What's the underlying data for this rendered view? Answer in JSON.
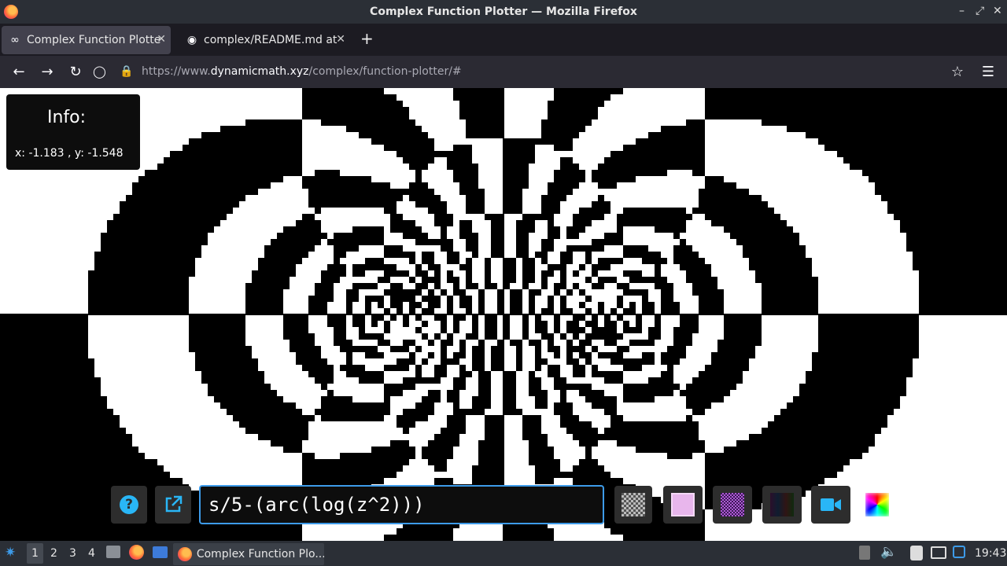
{
  "window": {
    "title": "Complex Function Plotter — Mozilla Firefox",
    "minimize_icon": "minimize-icon",
    "restore_icon": "restore-icon",
    "close_icon": "close-icon"
  },
  "tabs": [
    {
      "label": "Complex Function Plotter",
      "icon": "infinity-icon",
      "active": true
    },
    {
      "label": "complex/README.md at",
      "icon": "github-icon",
      "active": false
    }
  ],
  "nav": {
    "url_scheme": "https://www.",
    "url_host": "dynamicmath.xyz",
    "url_path": "/complex/function-plotter/#"
  },
  "info": {
    "title": "Info:",
    "coords": "x: -1.183 , y: -1.548"
  },
  "toolbar": {
    "help_label": "?",
    "function_value": "s/5-(arc(log(z^2)))"
  },
  "colors": {
    "accent": "#3d9be9",
    "help_blue": "#29b6f6",
    "panel": "#2d2d2d"
  },
  "taskbar": {
    "workspaces": [
      "1",
      "2",
      "3",
      "4"
    ],
    "task_label": "Complex Function Plo...",
    "clock": "19:43"
  }
}
